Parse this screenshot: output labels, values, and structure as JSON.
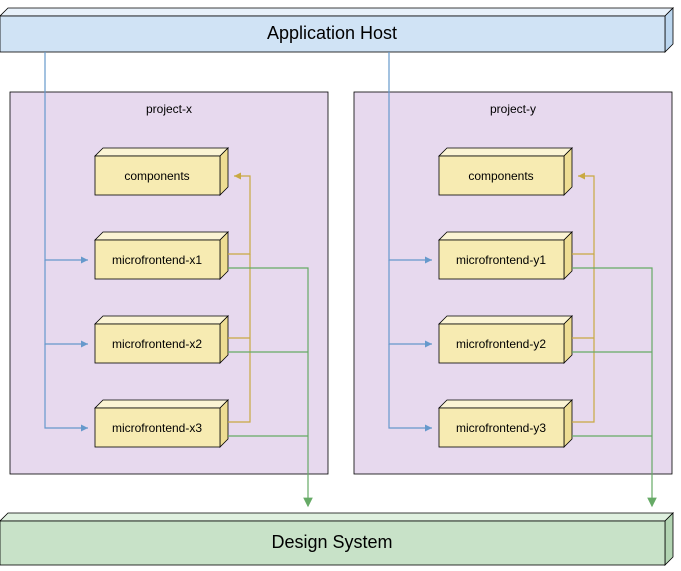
{
  "host": {
    "label": "Application Host"
  },
  "design_system": {
    "label": "Design System"
  },
  "projects": [
    {
      "name": "project-x",
      "modules": [
        {
          "label": "components",
          "kind": "components"
        },
        {
          "label": "microfrontend-x1",
          "kind": "microfrontend"
        },
        {
          "label": "microfrontend-x2",
          "kind": "microfrontend"
        },
        {
          "label": "microfrontend-x3",
          "kind": "microfrontend"
        }
      ]
    },
    {
      "name": "project-y",
      "modules": [
        {
          "label": "components",
          "kind": "components"
        },
        {
          "label": "microfrontend-y1",
          "kind": "microfrontend"
        },
        {
          "label": "microfrontend-y2",
          "kind": "microfrontend"
        },
        {
          "label": "microfrontend-y3",
          "kind": "microfrontend"
        }
      ]
    }
  ],
  "colors": {
    "host": "#D0E3F5",
    "project_bg": "#E7D9EE",
    "module": "#F7EBB2",
    "design_system": "#C8E2C8",
    "connector_host": "#6699CC",
    "connector_components": "#C9A942",
    "connector_design_system": "#66AA66"
  },
  "connections": {
    "host_to_microfrontends": true,
    "microfrontends_to_components": true,
    "microfrontends_to_design_system": true
  }
}
